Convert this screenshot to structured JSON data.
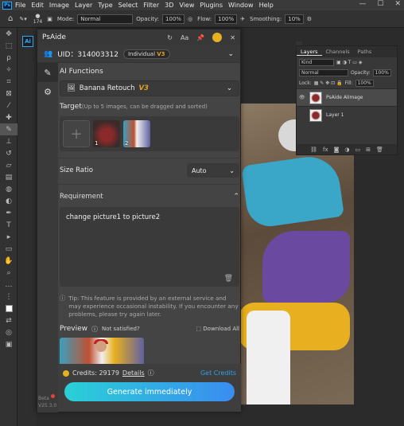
{
  "menubar": {
    "items": [
      "File",
      "Edit",
      "Image",
      "Layer",
      "Type",
      "Select",
      "Filter",
      "3D",
      "View",
      "Plugins",
      "Window",
      "Help"
    ],
    "window_controls": [
      "—",
      "☐",
      "✕"
    ]
  },
  "options": {
    "mode_label": "Mode:",
    "mode_value": "Normal",
    "opacity_label": "Opacity:",
    "opacity_value": "100%",
    "flow_label": "Flow:",
    "flow_value": "100%",
    "smoothing_label": "Smoothing:",
    "smoothing_value": "10%",
    "brush_size": "174"
  },
  "layers_panel": {
    "tabs": [
      "Layers",
      "Channels",
      "Paths"
    ],
    "kind_label": "Kind",
    "blend_mode": "Normal",
    "opacity_label": "Opacity:",
    "opacity_value": "100%",
    "lock_label": "Lock:",
    "fill_label": "Fill:",
    "fill_value": "100%",
    "layers": [
      {
        "name": "PsAide AIImage"
      },
      {
        "name": "Layer 1"
      }
    ]
  },
  "plugin": {
    "title": "PsAide",
    "uid_label": "UID：314003312",
    "plan": "Individual",
    "plan_badge": "V3",
    "ai_functions_label": "AI Functions",
    "function_value": "Banana Retouch",
    "function_badge": "V3",
    "target_label": "Target",
    "target_hint": "(Up to 5 images, can be dragged and sorted)",
    "images": [
      {
        "num": "1"
      },
      {
        "num": "2"
      }
    ],
    "size_ratio_label": "Size Ratio",
    "size_ratio_value": "Auto",
    "requirement_label": "Requirement",
    "requirement_text": "change picture1 to picture2",
    "tip": "Tip: This feature is provided by an external service and may experience occasional instability. If you encounter any problems, please try again later.",
    "preview_label": "Preview",
    "not_satisfied": "Not satisfied?",
    "download_all": "Download All",
    "credits_label": "Credits: 29179",
    "details": "Details",
    "get_credits": "Get Credits",
    "generate_button": "Generate immediately",
    "beta_label": "Beta",
    "version": "V25.3.0"
  },
  "colors": {
    "accent": "#31a8ff",
    "gold": "#e8a020",
    "button_start": "#2ad0d8",
    "button_end": "#3a8cf0"
  }
}
